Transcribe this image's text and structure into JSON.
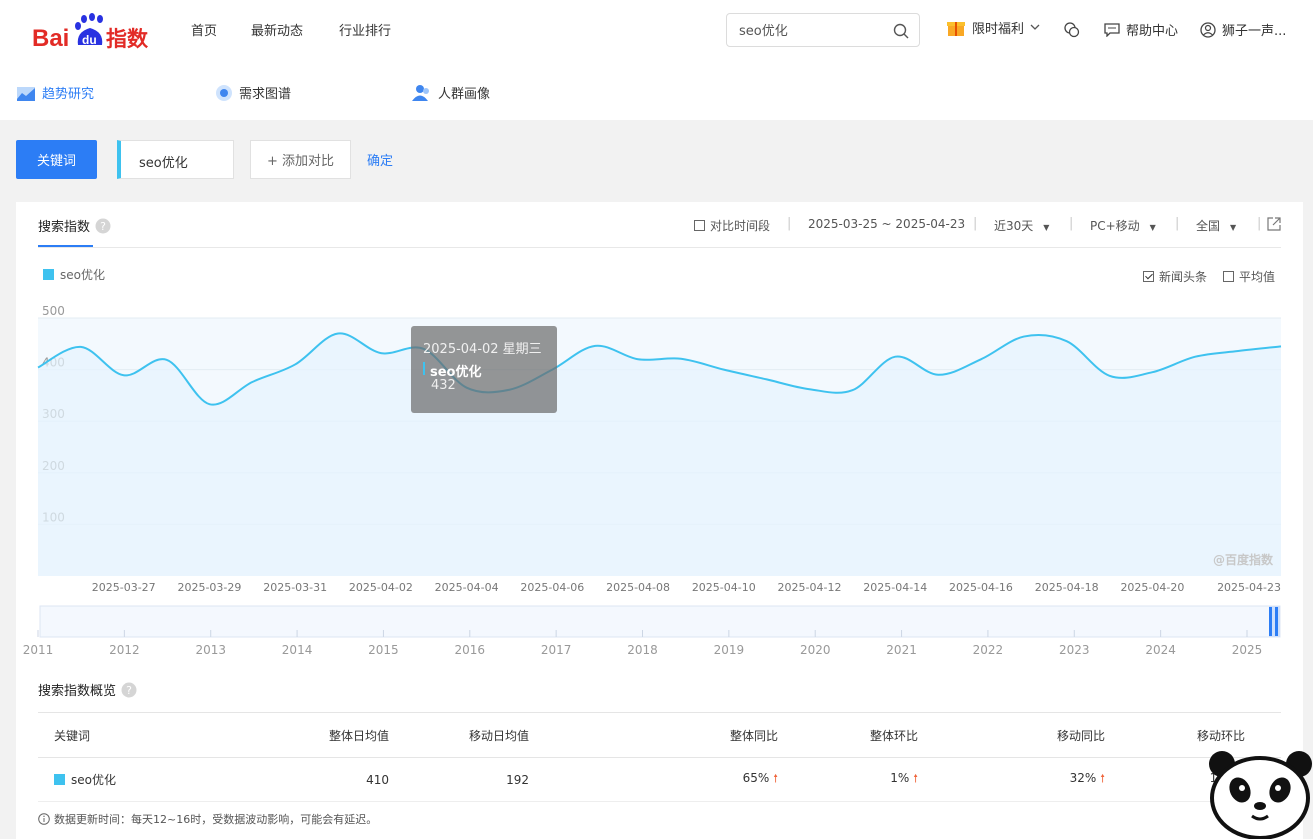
{
  "brand": {
    "logo_text_bai": "Bai",
    "logo_text_du": "du",
    "logo_text_index": "指数"
  },
  "nav": [
    "首页",
    "最新动态",
    "行业排行"
  ],
  "search": {
    "value": "seo优化"
  },
  "header": {
    "promo": "限时福利",
    "help": "帮助中心",
    "user": "狮子一声..."
  },
  "subnav": [
    {
      "label": "趋势研究",
      "icon": "trend-icon"
    },
    {
      "label": "需求图谱",
      "icon": "graph-icon"
    },
    {
      "label": "人群画像",
      "icon": "people-icon"
    }
  ],
  "keyword_bar": {
    "keyword_button": "关键词",
    "keyword": "seo优化",
    "add_compare": "+ 添加对比",
    "confirm": "确定"
  },
  "panel": {
    "title": "搜索指数",
    "compare_period": "对比时间段",
    "date_range": "2025-03-25 ~ 2025-04-23",
    "period_select": "近30天",
    "device_select": "PC+移动",
    "region_select": "全国",
    "news_headlines": "新闻头条",
    "average": "平均值",
    "watermark": "@百度指数"
  },
  "chart_data": {
    "type": "area",
    "legend": [
      {
        "name": "seo优化",
        "color": "#3ec2ef"
      }
    ],
    "ylim": [
      0,
      500
    ],
    "yticks": [
      100,
      200,
      300,
      400,
      500
    ],
    "x": [
      "2025-03-25",
      "2025-03-26",
      "2025-03-27",
      "2025-03-28",
      "2025-03-29",
      "2025-03-30",
      "2025-03-31",
      "2025-04-01",
      "2025-04-02",
      "2025-04-03",
      "2025-04-04",
      "2025-04-05",
      "2025-04-06",
      "2025-04-07",
      "2025-04-08",
      "2025-04-09",
      "2025-04-10",
      "2025-04-11",
      "2025-04-12",
      "2025-04-13",
      "2025-04-14",
      "2025-04-15",
      "2025-04-16",
      "2025-04-17",
      "2025-04-18",
      "2025-04-19",
      "2025-04-20",
      "2025-04-21",
      "2025-04-22",
      "2025-04-23"
    ],
    "xtick_labels": [
      "2025-03-27",
      "2025-03-29",
      "2025-03-31",
      "2025-04-02",
      "2025-04-04",
      "2025-04-06",
      "2025-04-08",
      "2025-04-10",
      "2025-04-12",
      "2025-04-14",
      "2025-04-16",
      "2025-04-18",
      "2025-04-20",
      "2025-04-23"
    ],
    "series": [
      {
        "name": "seo优化",
        "values": [
          404,
          444,
          389,
          419,
          333,
          376,
          410,
          470,
          432,
          440,
          365,
          361,
          400,
          446,
          420,
          421,
          400,
          381,
          362,
          360,
          425,
          390,
          420,
          464,
          455,
          388,
          395,
          425,
          436,
          445
        ]
      }
    ],
    "tooltip": {
      "date": "2025-04-02 星期三",
      "series": "seo优化",
      "value": "432"
    },
    "overview_years": [
      "2011",
      "2012",
      "2013",
      "2014",
      "2015",
      "2016",
      "2017",
      "2018",
      "2019",
      "2020",
      "2021",
      "2022",
      "2023",
      "2024",
      "2025"
    ]
  },
  "overview": {
    "title": "搜索指数概览",
    "columns": [
      "关键词",
      "整体日均值",
      "移动日均值",
      "整体同比",
      "整体环比",
      "移动同比",
      "移动环比"
    ],
    "rows": [
      {
        "keyword": "seo优化",
        "overall_avg": "410",
        "mobile_avg": "192",
        "overall_yoy": "65%",
        "overall_mom": "1%",
        "mobile_yoy": "32%",
        "mobile_mom": "10%"
      }
    ],
    "note": "数据更新时间：每天12~16时，受数据波动影响，可能会有延迟。"
  }
}
